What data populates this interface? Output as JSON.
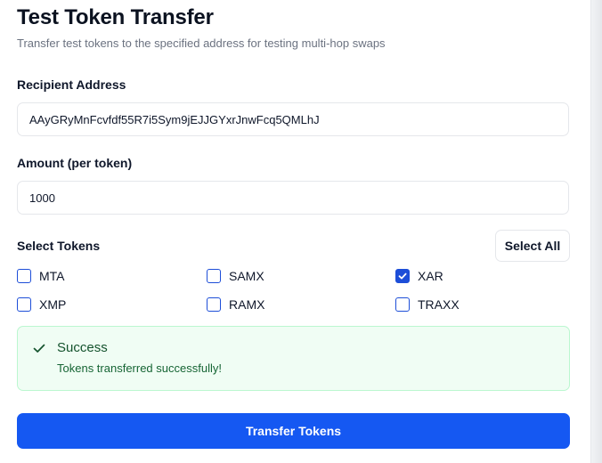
{
  "header": {
    "title": "Test Token Transfer",
    "subtitle": "Transfer test tokens to the specified address for testing multi-hop swaps"
  },
  "recipient": {
    "label": "Recipient Address",
    "value": "AAyGRyMnFcvfdf55R7i5Sym9jEJJGYxrJnwFcq5QMLhJ"
  },
  "amount": {
    "label": "Amount (per token)",
    "value": "1000"
  },
  "tokens": {
    "label": "Select Tokens",
    "select_all_label": "Select All",
    "items": [
      {
        "label": "MTA",
        "checked": false
      },
      {
        "label": "SAMX",
        "checked": false
      },
      {
        "label": "XAR",
        "checked": true
      },
      {
        "label": "XMP",
        "checked": false
      },
      {
        "label": "RAMX",
        "checked": false
      },
      {
        "label": "TRAXX",
        "checked": false
      }
    ]
  },
  "alert": {
    "title": "Success",
    "description": "Tokens transferred successfully!",
    "icon": "check-icon",
    "color": "#14532d"
  },
  "submit": {
    "label": "Transfer Tokens",
    "color": "#1558f2"
  },
  "colors": {
    "accent": "#1d4ed8",
    "success_bg": "#f0fdf4",
    "success_border": "#bbf7d0"
  }
}
